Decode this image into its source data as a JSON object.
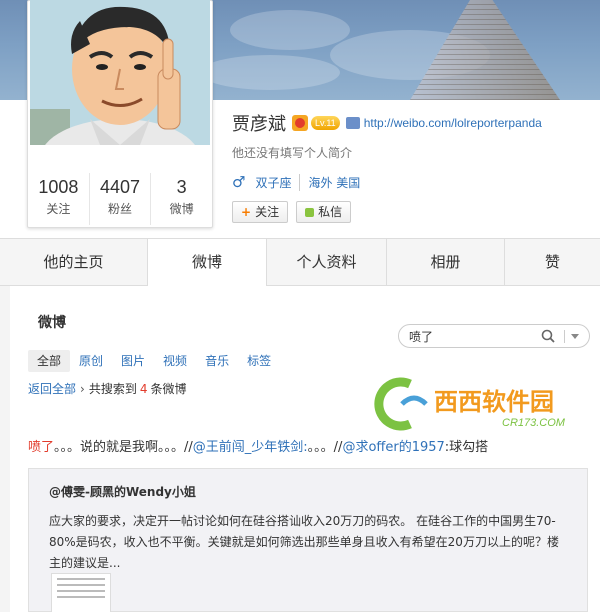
{
  "profile": {
    "name": "贾彦斌",
    "level_badge": "Lv.11",
    "url": "http://weibo.com/lolreporterpanda",
    "bio": "他还没有填写个人简介",
    "gender_symbol": "♂",
    "tags": [
      "双子座",
      "海外 美国"
    ],
    "follow_label": "关注",
    "message_label": "私信"
  },
  "stats": [
    {
      "num": "1008",
      "label": "关注"
    },
    {
      "num": "4407",
      "label": "粉丝"
    },
    {
      "num": "3",
      "label": "微博"
    }
  ],
  "tabs": [
    "他的主页",
    "微博",
    "个人资料",
    "相册",
    "赞"
  ],
  "active_tab": "微博",
  "main": {
    "section_title": "微博",
    "search_value": "喷了",
    "filters": [
      "全部",
      "原创",
      "图片",
      "视频",
      "音乐",
      "标签"
    ],
    "breadcrumb": {
      "back_label": "返回全部",
      "prefix": "共搜索到",
      "count": "4",
      "suffix": "条微博"
    }
  },
  "watermark": {
    "text": "西西软件园",
    "sub": "CR173.COM"
  },
  "post": {
    "highlight": "喷了",
    "text_1": "。。。说的就是我啊。。。//",
    "mention_1": "@王前闯_少年铁剑:",
    "text_2": "。。。//",
    "mention_2": "@求offer的1957",
    "text_3": ":球勾搭"
  },
  "repost": {
    "author": "@傅雯-顾黑的Wendy小姐",
    "body": "应大家的要求，决定开一帖讨论如何在硅谷搭讪收入20万刀的码农。 在硅谷工作的中国男生70-80%是码农，收入也不平衡。关键就是如何筛选出那些单身且收入有希望在20万刀以上的呢？楼主的建议是..."
  },
  "colors": {
    "link": "#2f71b8",
    "highlight": "#e23c2c",
    "follow_plus": "#f77c00"
  }
}
